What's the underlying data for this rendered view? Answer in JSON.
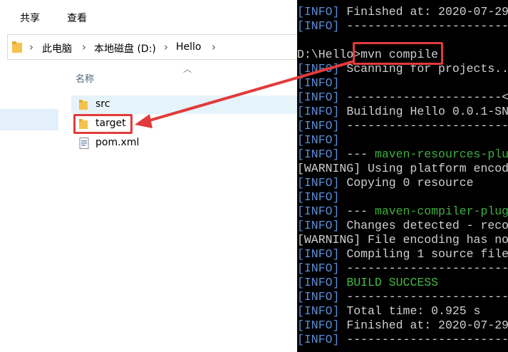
{
  "ribbon": {
    "tabs": [
      "共享",
      "查看"
    ]
  },
  "address": {
    "path": [
      "此电脑",
      "本地磁盘 (D:)",
      "Hello"
    ]
  },
  "list": {
    "column_name": "名称",
    "items": [
      {
        "name": "src",
        "type": "folder"
      },
      {
        "name": "target",
        "type": "folder"
      },
      {
        "name": "pom.xml",
        "type": "xml"
      }
    ]
  },
  "terminal": {
    "lines": [
      {
        "prefix": "[INFO]",
        "text": " Finished at: 2020-07-29",
        "kind": "info"
      },
      {
        "prefix": "[INFO]",
        "text": " ------------------------",
        "kind": "info"
      },
      {
        "prefix": "",
        "text": "",
        "kind": "plain"
      },
      {
        "prefix": "",
        "text": "D:\\Hello>mvn compile",
        "kind": "plain"
      },
      {
        "prefix": "[INFO]",
        "text": " Scanning for projects...",
        "kind": "info"
      },
      {
        "prefix": "[INFO]",
        "text": "",
        "kind": "info"
      },
      {
        "prefix": "[INFO]",
        "text": " ----------------------<",
        "kind": "info"
      },
      {
        "prefix": "[INFO]",
        "text": " Building Hello 0.0.1-SN",
        "kind": "info"
      },
      {
        "prefix": "[INFO]",
        "text": " ------------------------",
        "kind": "info"
      },
      {
        "prefix": "[INFO]",
        "text": "",
        "kind": "info"
      },
      {
        "prefix": "[INFO]",
        "text": " --- ",
        "green": "maven-resources-plu",
        "kind": "info"
      },
      {
        "prefix": "[WARNING]",
        "text": " Using platform encod",
        "kind": "warn"
      },
      {
        "prefix": "[INFO]",
        "text": " Copying 0 resource",
        "kind": "info"
      },
      {
        "prefix": "[INFO]",
        "text": "",
        "kind": "info"
      },
      {
        "prefix": "[INFO]",
        "text": " --- ",
        "green": "maven-compiler-plug",
        "kind": "info"
      },
      {
        "prefix": "[INFO]",
        "text": " Changes detected - reco",
        "kind": "info"
      },
      {
        "prefix": "[WARNING]",
        "text": " File encoding has no",
        "kind": "warn"
      },
      {
        "prefix": "[INFO]",
        "text": " Compiling 1 source file",
        "kind": "info"
      },
      {
        "prefix": "[INFO]",
        "text": " ------------------------",
        "kind": "info"
      },
      {
        "prefix": "[INFO]",
        "text": " ",
        "success": "BUILD SUCCESS",
        "kind": "info"
      },
      {
        "prefix": "[INFO]",
        "text": " ------------------------",
        "kind": "info"
      },
      {
        "prefix": "[INFO]",
        "text": " Total time: 0.925 s",
        "kind": "info"
      },
      {
        "prefix": "[INFO]",
        "text": " Finished at: 2020-07-29",
        "kind": "info"
      },
      {
        "prefix": "[INFO]",
        "text": " ------------------------",
        "kind": "info"
      }
    ]
  },
  "colors": {
    "annotation": "#e23b3b",
    "terminal_bg": "#000000",
    "info": "#5b8dd8",
    "green": "#3fae3f"
  }
}
